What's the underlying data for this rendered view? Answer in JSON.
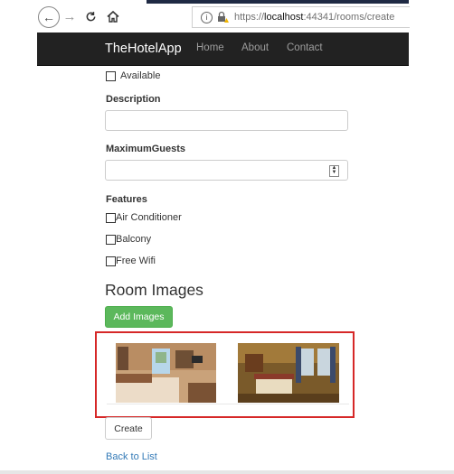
{
  "browser": {
    "url_prefix": "https://",
    "url_host": "localhost",
    "url_rest": ":44341/rooms/create"
  },
  "navbar": {
    "brand": "TheHotelApp",
    "links": [
      "Home",
      "About",
      "Contact"
    ]
  },
  "form": {
    "available_label": "Available",
    "available_checked": false,
    "description_label": "Description",
    "description_value": "",
    "max_guests_label": "MaximumGuests",
    "max_guests_value": "",
    "features_label": "Features",
    "features": [
      {
        "label": "Air Conditioner",
        "checked": false
      },
      {
        "label": "Balcony",
        "checked": false
      },
      {
        "label": "Free Wifi",
        "checked": false
      }
    ]
  },
  "images_section": {
    "title": "Room Images",
    "add_button": "Add Images"
  },
  "actions": {
    "create_button": "Create",
    "back_link": "Back to List"
  },
  "colors": {
    "navbar_bg": "#222222",
    "success": "#5cb85c",
    "link": "#337ab7",
    "highlight": "#d62828"
  }
}
